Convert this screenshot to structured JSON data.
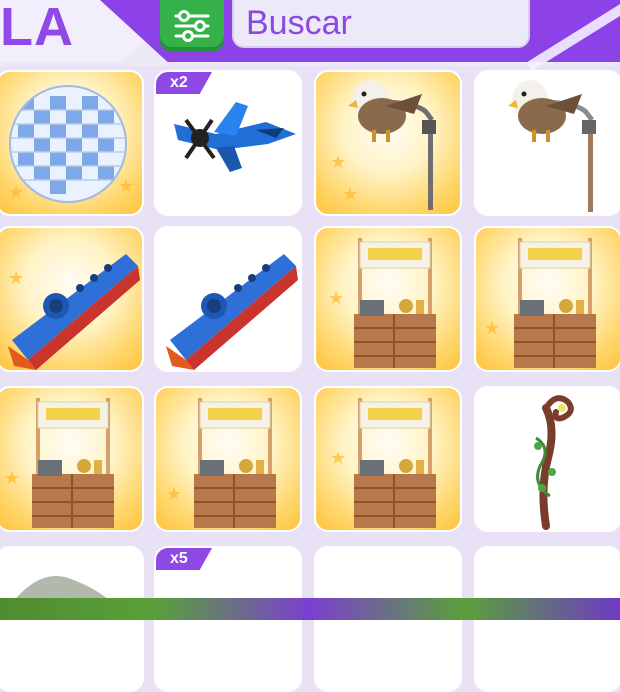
{
  "header": {
    "title_fragment": "LA",
    "search_placeholder": "Buscar",
    "filter_icon": "sliders-icon"
  },
  "items": [
    {
      "name": "disco-ball",
      "badge": "",
      "bg": "gold"
    },
    {
      "name": "blue-airplane",
      "badge": "x2",
      "bg": "white"
    },
    {
      "name": "griffin-lamp-post",
      "badge": "",
      "bg": "gold"
    },
    {
      "name": "griffin-lamp-post",
      "badge": "",
      "bg": "white"
    },
    {
      "name": "blue-kazoo",
      "badge": "",
      "bg": "gold"
    },
    {
      "name": "blue-kazoo",
      "badge": "",
      "bg": "white"
    },
    {
      "name": "lemonade-stand",
      "badge": "",
      "bg": "gold"
    },
    {
      "name": "lemonade-stand",
      "badge": "",
      "bg": "gold"
    },
    {
      "name": "lemonade-stand",
      "badge": "",
      "bg": "gold"
    },
    {
      "name": "lemonade-stand",
      "badge": "",
      "bg": "gold"
    },
    {
      "name": "lemonade-stand",
      "badge": "",
      "bg": "gold"
    },
    {
      "name": "vine-staff",
      "badge": "",
      "bg": "white"
    },
    {
      "name": "partial-item",
      "badge": "",
      "bg": "white"
    },
    {
      "name": "partial-item",
      "badge": "x5",
      "bg": "white"
    },
    {
      "name": "partial-item",
      "badge": "",
      "bg": "white"
    },
    {
      "name": "partial-item",
      "badge": "",
      "bg": "white"
    }
  ],
  "colors": {
    "accent_purple": "#8c42e6",
    "filter_green": "#35b14a",
    "gold": "#ffc43c"
  }
}
